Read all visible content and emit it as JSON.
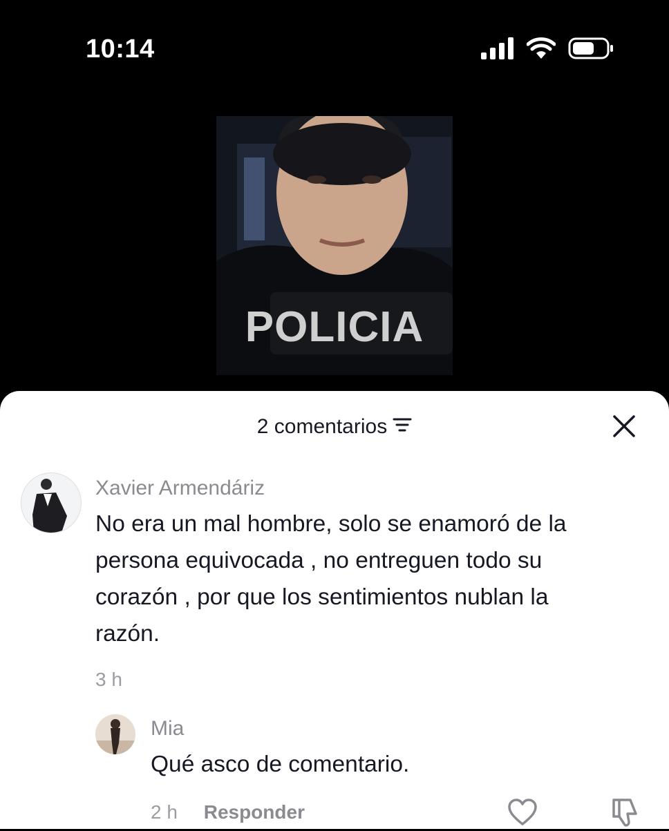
{
  "status_bar": {
    "time": "10:14",
    "icons": [
      "signal-icon",
      "wifi-icon",
      "battery-icon"
    ]
  },
  "video": {
    "vest_text": "POLICIA"
  },
  "comments_sheet": {
    "title": "2 comentarios",
    "comments": [
      {
        "username": "Xavier Armendáriz",
        "text": "No era un mal hombre, solo se enamoró de la persona equivocada , no entreguen todo su corazón , por que los sentimientos nublan la razón.",
        "lines": [
          "No era un mal hombre, solo se enamoró de la",
          "persona equivocada , no entreguen todo su",
          "corazón , por que los sentimientos nublan la",
          "razón."
        ],
        "time": "3 h"
      }
    ],
    "replies": [
      {
        "username": "Mia",
        "text": "Qué asco de comentario.",
        "time": "2 h",
        "reply_label": "Responder"
      }
    ]
  },
  "colors": {
    "sheet_bg": "#ffffff",
    "primary_text": "#161823",
    "secondary_text": "#8a8b91"
  }
}
